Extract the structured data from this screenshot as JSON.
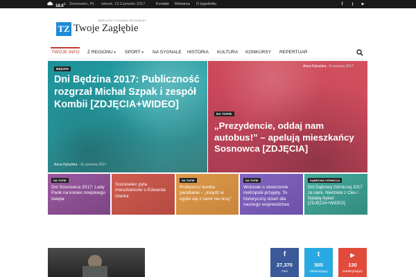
{
  "topbar": {
    "temperature": "18.6",
    "temp_unit": "C",
    "city": "Sosnowiec, PL",
    "date": "wtorek, 13 Czerwiec 2017",
    "links": [
      "Kontakt",
      "Reklama",
      "O tygodniku"
    ],
    "social_icons": [
      "facebook-icon",
      "twitter-icon",
      "youtube-icon"
    ]
  },
  "logo": {
    "mark": "TZ",
    "name": "Twoje Zagłębie",
    "tagline": "BEZPŁATNY TYGODNIK REGIONALNY"
  },
  "nav": {
    "items": [
      "TWOJE INFO",
      "Z REGIONU",
      "SPORT",
      "NA SYGNALE",
      "HISTORIA",
      "KULTURA",
      "KONKURSY",
      "REPERTUAR"
    ],
    "active": "TWOJE INFO",
    "dropdown_items": [
      "Z REGIONU",
      "SPORT"
    ]
  },
  "featured": [
    {
      "category": "BĘDZIN",
      "title": "Dni Będzina 2017: Publiczność rozgrzał Michał Szpak i zespół Kombii [ZDJĘCIA+WIDEO]",
      "author": "Anna Rykulska",
      "date": "11 czerwca 2017",
      "color": "#2aa3a8"
    },
    {
      "category": "NA TOPIE",
      "title": "„Prezydencie, oddaj nam autobus!” – apelują mieszkańcy Sosnowca [ZDJĘCIA]",
      "author": "Anna Rykulska",
      "date": "8 czerwca 2017",
      "color": "#c9475a"
    }
  ],
  "small_tiles": [
    {
      "category": "NA TOPIE",
      "title": "Dni Sosnowca 2017: Lady Pank na koniec miejskiego święta",
      "color": "#8e4f93"
    },
    {
      "category": "",
      "title": "Sosnowiec pyta mieszkańców o Edwarda Gierka",
      "color": "#c3544a"
    },
    {
      "category": "NA TOPIE",
      "title": "Proboszcz kontra parafianie – „księdz w ogóle się z nami nie liczy”",
      "color": "#d59143"
    },
    {
      "category": "NA TOPIE",
      "title": "Wniosek o utworzenie metropolii przyjęty. To historyczny dzień dla naszego województwa",
      "color": "#7b5cb8"
    },
    {
      "category": "DĄBROWA GÓRNICZA",
      "title": "Dni Dąbrowy Górniczej 2017 za nami. Niedziela z Cleo i Natalią Nykiel [ZDJĘCIA+WIDEO]",
      "color": "#3fa396"
    }
  ],
  "social_counters": [
    {
      "icon": "facebook-icon",
      "glyph": "f",
      "count": "27,370",
      "label": "Fani",
      "color": "#3b5998"
    },
    {
      "icon": "twitter-icon",
      "glyph": "t",
      "count": "505",
      "label": "Obserwujący",
      "color": "#29a9e1"
    },
    {
      "icon": "youtube-icon",
      "glyph": "▶",
      "count": "130",
      "label": "Subskrybujący",
      "color": "#e14b3b"
    }
  ]
}
